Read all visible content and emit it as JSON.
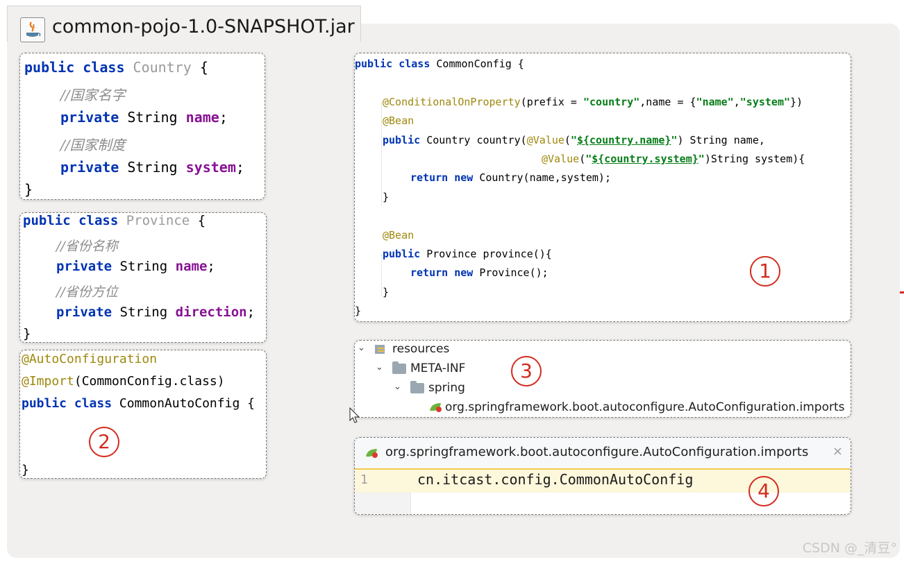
{
  "window": {
    "title": "common-pojo-1.0-SNAPSHOT.jar"
  },
  "country_class": {
    "l1": {
      "kw": "public class",
      "name": "Country",
      "brace": "{"
    },
    "l2": "//国家名字",
    "l3": {
      "kw": "private",
      "type": "String",
      "field": "name",
      "end": ";"
    },
    "l4": "//国家制度",
    "l5": {
      "kw": "private",
      "type": "String",
      "field": "system",
      "end": ";"
    },
    "l6": "}"
  },
  "province_class": {
    "l1": {
      "kw": "public class",
      "name": "Province",
      "brace": "{"
    },
    "l2": "//省份名称",
    "l3": {
      "kw": "private",
      "type": "String",
      "field": "name",
      "end": ";"
    },
    "l4": "//省份方位",
    "l5": {
      "kw": "private",
      "type": "String",
      "field": "direction",
      "end": ";"
    },
    "l6": "}"
  },
  "auto_config": {
    "l1": "@AutoConfiguration",
    "l2": {
      "ann": "@Import",
      "rest": "(CommonConfig.class)"
    },
    "l3": {
      "kw": "public class",
      "rest": "CommonAutoConfig {"
    },
    "l4": "}"
  },
  "common_config": {
    "l1": {
      "kw": "public class",
      "rest": "CommonConfig {"
    },
    "l2": {
      "ann": "@ConditionalOnProperty",
      "p1": "(prefix = ",
      "s1": "\"country\"",
      "p2": ",name = {",
      "s2": "\"name\"",
      "p3": ",",
      "s3": "\"system\"",
      "p4": "})"
    },
    "l3": "@Bean",
    "l4": {
      "kw": "public",
      "p1": " Country country(",
      "ann": "@Value",
      "p2": "(",
      "q1": "\"",
      "s": "${country.name}",
      "q2": "\"",
      "p3": ") String name,"
    },
    "l5": {
      "ann": "@Value",
      "p1": "(",
      "q1": "\"",
      "s": "${country.system}",
      "q2": "\"",
      "p2": ")String system){"
    },
    "l6": {
      "kw": "return new",
      "rest": " Country(name,system);"
    },
    "l7": "}",
    "l8": "@Bean",
    "l9": {
      "kw": "public",
      "rest": " Province province(){"
    },
    "l10": {
      "kw": "return new",
      "rest": " Province();"
    },
    "l11": "}",
    "l12": "}"
  },
  "tree": {
    "resources": "resources",
    "meta_inf": "META-INF",
    "spring": "spring",
    "imports_file": "org.springframework.boot.autoconfigure.AutoConfiguration.imports"
  },
  "editor": {
    "tab_label": "org.springframework.boot.autoconfigure.AutoConfiguration.imports",
    "close": "×",
    "line_number": "1",
    "line_content": "cn.itcast.config.CommonAutoConfig"
  },
  "markers": {
    "m1": "1",
    "m2": "2",
    "m3": "3",
    "m4": "4"
  },
  "watermark": "CSDN @_清豆°",
  "colors": {
    "keyword": "#0033b3",
    "annotation": "#9e880d",
    "string": "#067d17",
    "field": "#871094",
    "comment": "#8c8c8c",
    "marker": "#d22b1f"
  },
  "icons": [
    "java-jar-icon",
    "folder-icon",
    "spring-leaf-icon",
    "cursor-icon"
  ]
}
